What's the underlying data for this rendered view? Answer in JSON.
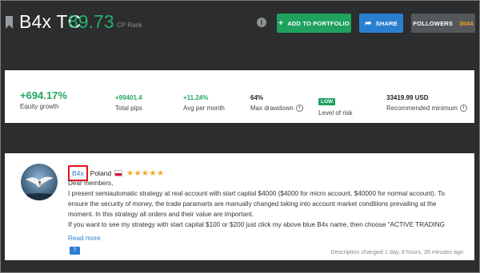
{
  "header": {
    "title": "B4x TC",
    "rank": "89.73",
    "rank_label": "CP Rank",
    "info_icon": "i",
    "add_portfolio_label": "ADD TO PORTFOLIO",
    "share_label": "SHARE",
    "followers_label": "FOLLOWERS",
    "followers_count": "3044"
  },
  "stats": {
    "equity_growth": {
      "value": "+694.17%",
      "label": "Equity growth"
    },
    "total_pips": {
      "value": "+99401.4",
      "label": "Total pips"
    },
    "avg_per_month": {
      "value": "+11.24%",
      "label": "Avg per month"
    },
    "max_drawdown": {
      "value": "64%",
      "label": "Max drawdown"
    },
    "risk": {
      "value": "LOW",
      "label": "Level of risk"
    },
    "recommended_minimum": {
      "value": "33419.99 USD",
      "label": "Recommended minimum"
    }
  },
  "profile": {
    "username": "B4x",
    "country": "Poland",
    "stars": "★★★★★",
    "rating": 5,
    "description": [
      "Dear members,",
      "I present semiautomatic strategy at real account with start capital $4000 ($4000 for micro account, $40000 for normal account). To ensure the security of money, the trade paramarts are manually changed taking into account market conditions prevailing at the moment. In this strategy all orders and their value are important.",
      "If you want to see my strategy with start capital $100 or $200 just click my above blue B4x name, then choose \"ACTIVE TRADING"
    ],
    "read_more": "Read more",
    "comments_count": "7",
    "changed": "Description changed 1 day, 8 hours, 35 minutes ago"
  },
  "colors": {
    "background": "#2b2d2e",
    "green": "#23a565",
    "blue": "#2b7fd1",
    "followers_count": "#f5a623",
    "highlight": "#e2151b"
  }
}
